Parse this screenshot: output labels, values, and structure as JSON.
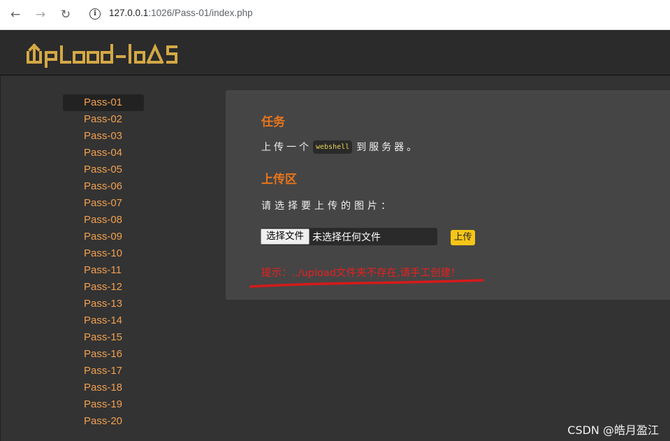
{
  "browser": {
    "url_host": "127.0.0.1",
    "url_rest": ":1026/Pass-01/index.php",
    "back_icon": "arrow-left-icon",
    "forward_icon": "arrow-right-icon",
    "reload_icon": "reload-icon"
  },
  "header": {
    "logo_text": "upload-labs"
  },
  "sidebar": {
    "items": [
      {
        "label": "Pass-01",
        "active": true
      },
      {
        "label": "Pass-02"
      },
      {
        "label": "Pass-03"
      },
      {
        "label": "Pass-04"
      },
      {
        "label": "Pass-05"
      },
      {
        "label": "Pass-06"
      },
      {
        "label": "Pass-07"
      },
      {
        "label": "Pass-08"
      },
      {
        "label": "Pass-09"
      },
      {
        "label": "Pass-10"
      },
      {
        "label": "Pass-11"
      },
      {
        "label": "Pass-12"
      },
      {
        "label": "Pass-13"
      },
      {
        "label": "Pass-14"
      },
      {
        "label": "Pass-15"
      },
      {
        "label": "Pass-16"
      },
      {
        "label": "Pass-17"
      },
      {
        "label": "Pass-18"
      },
      {
        "label": "Pass-19"
      },
      {
        "label": "Pass-20"
      }
    ]
  },
  "main": {
    "task_title": "任务",
    "task_before": "上传一个",
    "task_code": "webshell",
    "task_after": "到服务器。",
    "upload_title": "上传区",
    "prompt": "请选择要上传的图片：",
    "file_button": "选择文件",
    "file_status": "未选择任何文件",
    "upload_button": "上传",
    "hint": "提示：../upload文件夹不存在,请手工创建！"
  },
  "watermark": "CSDN @皓月盈江",
  "colors": {
    "accent_orange": "#e8751a",
    "menu_link": "#f0a050",
    "upload_button": "#f5c518",
    "hint_red": "#e82020",
    "logo": "#d4a845"
  }
}
